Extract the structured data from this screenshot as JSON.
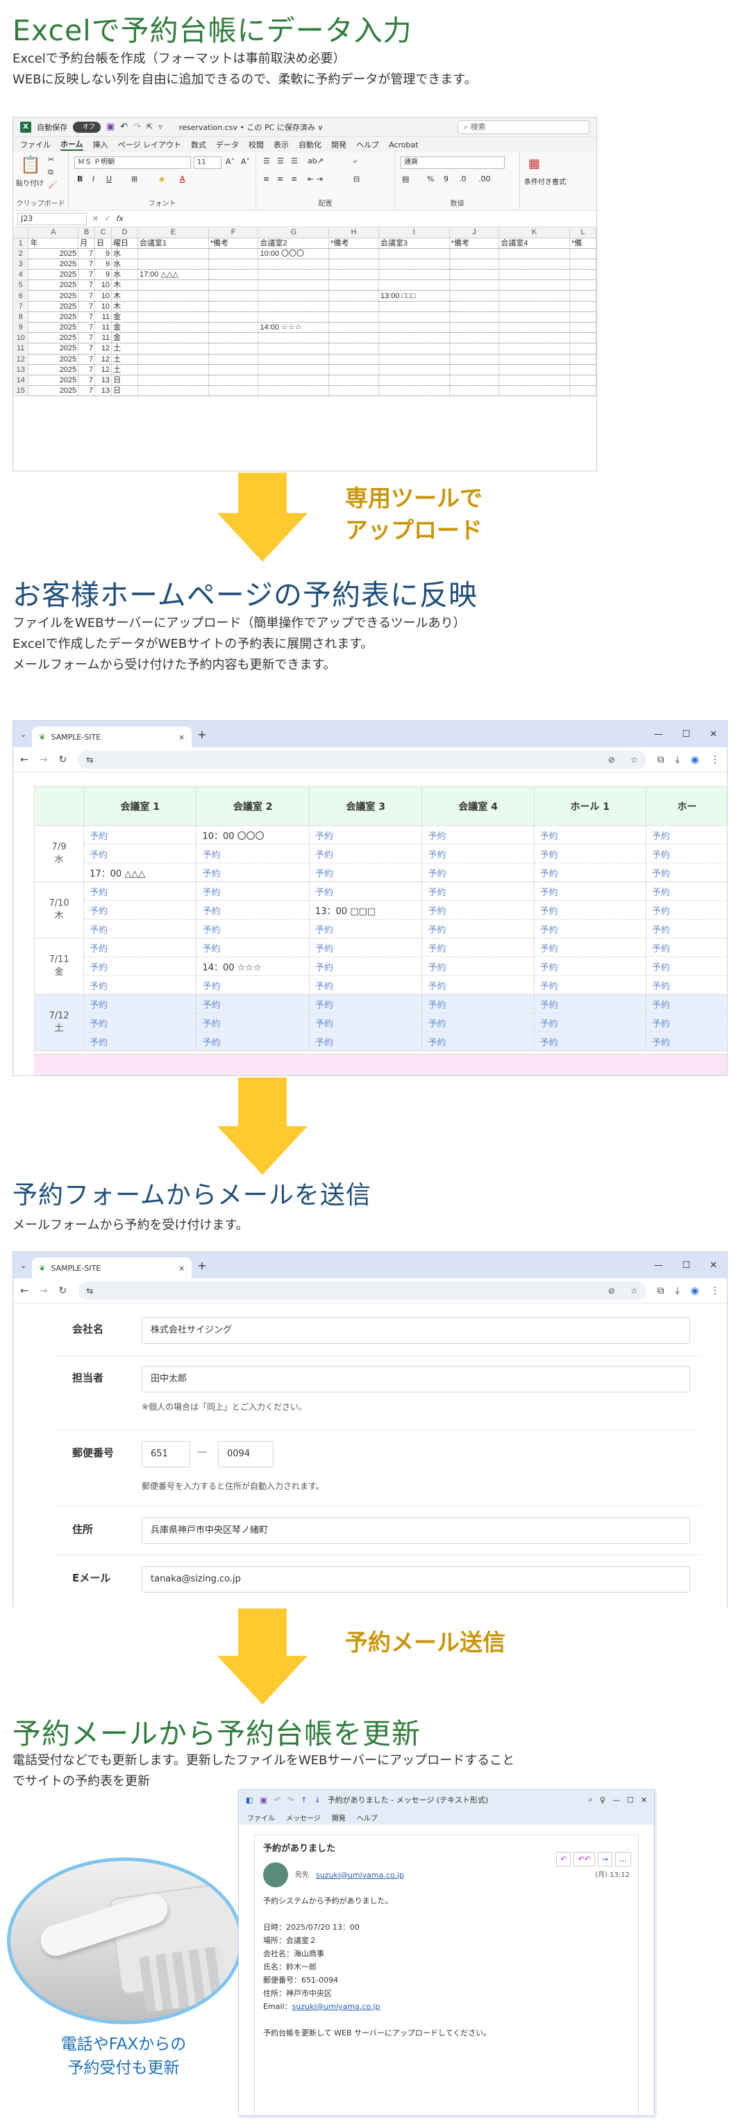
{
  "section1": {
    "title": "Excelで予約台帳にデータ入力",
    "desc": [
      "Excelで予約台帳を作成（フォーマットは事前取決め必要）",
      "WEBに反映しない列を自由に追加できるので、柔軟に予約データが管理できます。"
    ]
  },
  "excel": {
    "autosave": "自動保存",
    "toggle": "オフ",
    "filename": "reservation.csv • この PC に保存済み ∨",
    "search": "検索",
    "menu": [
      "ファイル",
      "ホーム",
      "挿入",
      "ページ レイアウト",
      "数式",
      "データ",
      "校閲",
      "表示",
      "自動化",
      "開発",
      "ヘルプ",
      "Acrobat"
    ],
    "font": "ＭＳ Ｐ明朝",
    "fontsize": "11",
    "numformat": "通貨",
    "paste": "貼り付け",
    "groups": [
      "クリップボード",
      "フォント",
      "配置",
      "数値"
    ],
    "condfmt": "条件付き書式",
    "namebox": "J23",
    "fx": "fx",
    "columns": [
      "",
      "A",
      "B",
      "C",
      "D",
      "E",
      "F",
      "G",
      "H",
      "I",
      "J",
      "K",
      "L"
    ],
    "header": [
      "年",
      "月",
      "日",
      "曜日",
      "会議室1",
      "*備考",
      "会議室2",
      "*備考",
      "会議室3",
      "*備考",
      "会議室4",
      "*備"
    ],
    "rows": [
      [
        "2025",
        "7",
        "9",
        "水",
        "",
        "",
        "10:00 〇〇〇",
        "",
        "",
        "",
        "",
        ""
      ],
      [
        "2025",
        "7",
        "9",
        "水",
        "",
        "",
        "",
        "",
        "",
        "",
        "",
        ""
      ],
      [
        "2025",
        "7",
        "9",
        "水",
        "17:00 △△△",
        "",
        "",
        "",
        "",
        "",
        "",
        ""
      ],
      [
        "2025",
        "7",
        "10",
        "木",
        "",
        "",
        "",
        "",
        "",
        "",
        "",
        ""
      ],
      [
        "2025",
        "7",
        "10",
        "木",
        "",
        "",
        "",
        "",
        "13:00 □□□",
        "",
        "",
        ""
      ],
      [
        "2025",
        "7",
        "10",
        "木",
        "",
        "",
        "",
        "",
        "",
        "",
        "",
        ""
      ],
      [
        "2025",
        "7",
        "11",
        "金",
        "",
        "",
        "",
        "",
        "",
        "",
        "",
        ""
      ],
      [
        "2025",
        "7",
        "11",
        "金",
        "",
        "",
        "14:00 ☆☆☆",
        "",
        "",
        "",
        "",
        ""
      ],
      [
        "2025",
        "7",
        "11",
        "金",
        "",
        "",
        "",
        "",
        "",
        "",
        "",
        ""
      ],
      [
        "2025",
        "7",
        "12",
        "土",
        "",
        "",
        "",
        "",
        "",
        "",
        "",
        ""
      ],
      [
        "2025",
        "7",
        "12",
        "土",
        "",
        "",
        "",
        "",
        "",
        "",
        "",
        ""
      ],
      [
        "2025",
        "7",
        "12",
        "土",
        "",
        "",
        "",
        "",
        "",
        "",
        "",
        ""
      ],
      [
        "2025",
        "7",
        "13",
        "日",
        "",
        "",
        "",
        "",
        "",
        "",
        "",
        ""
      ],
      [
        "2025",
        "7",
        "13",
        "日",
        "",
        "",
        "",
        "",
        "",
        "",
        "",
        ""
      ]
    ]
  },
  "arrow1": [
    "専用ツールで",
    "アップロード"
  ],
  "section2": {
    "title": "お客様ホームページの予約表に反映",
    "desc": [
      "ファイルをWEBサーバーにアップロード（簡単操作でアップできるツールあり）",
      "Excelで作成したデータがWEBサイトの予約表に展開されます。",
      "メールフォームから受け付けた予約内容も更新できます。"
    ]
  },
  "browser": {
    "tab": "SAMPLE-SITE",
    "close": "×",
    "newtab": "+",
    "url_icon": "⇆"
  },
  "schedule": {
    "columns": [
      "会議室 1",
      "会議室 2",
      "会議室 3",
      "会議室 4",
      "ホール 1",
      "ホー"
    ],
    "days": [
      {
        "date": "7/9",
        "dow": "水",
        "type": "",
        "slots": [
          [
            "予約",
            "10：00 〇〇〇",
            "予約",
            "予約",
            "予約",
            "予約"
          ],
          [
            "予約",
            "予約",
            "予約",
            "予約",
            "予約",
            "予約"
          ],
          [
            "17：00 △△△",
            "予約",
            "予約",
            "予約",
            "予約",
            "予約"
          ]
        ]
      },
      {
        "date": "7/10",
        "dow": "木",
        "type": "",
        "slots": [
          [
            "予約",
            "予約",
            "予約",
            "予約",
            "予約",
            "予約"
          ],
          [
            "予約",
            "予約",
            "13：00 □□□",
            "予約",
            "予約",
            "予約"
          ],
          [
            "予約",
            "予約",
            "予約",
            "予約",
            "予約",
            "予約"
          ]
        ]
      },
      {
        "date": "7/11",
        "dow": "金",
        "type": "",
        "slots": [
          [
            "予約",
            "予約",
            "予約",
            "予約",
            "予約",
            "予約"
          ],
          [
            "予約",
            "14：00 ☆☆☆",
            "予約",
            "予約",
            "予約",
            "予約"
          ],
          [
            "予約",
            "予約",
            "予約",
            "予約",
            "予約",
            "予約"
          ]
        ]
      },
      {
        "date": "7/12",
        "dow": "土",
        "type": "sat",
        "slots": [
          [
            "予約",
            "予約",
            "予約",
            "予約",
            "予約",
            "予約"
          ],
          [
            "予約",
            "予約",
            "予約",
            "予約",
            "予約",
            "予約"
          ],
          [
            "予約",
            "予約",
            "予約",
            "予約",
            "予約",
            "予約"
          ]
        ]
      }
    ]
  },
  "section3": {
    "title": "予約フォームからメールを送信",
    "desc": [
      "メールフォームから予約を受け付けます。"
    ]
  },
  "form": {
    "company_label": "会社名",
    "company_value": "株式会社サイジング",
    "person_label": "担当者",
    "person_value": "田中太郎",
    "person_note": "※個人の場合は「同上」とご入力ください。",
    "zip_label": "郵便番号",
    "zip1": "651",
    "zip_sep": "—",
    "zip2": "0094",
    "zip_note": "郵便番号を入力すると住所が自動入力されます。",
    "address_label": "住所",
    "address_value": "兵庫県神戸市中央区琴ノ緒町",
    "email_label": "Eメール",
    "email_value": "tanaka@sizing.co.jp"
  },
  "arrow3": [
    "予約メール送信"
  ],
  "section4": {
    "title": "予約メールから予約台帳を更新",
    "desc": [
      "電話受付などでも更新します。更新したファイルをWEBサーバーにアップロードすること",
      "でサイトの予約表を更新"
    ]
  },
  "mail": {
    "window_title": "予約がありました - メッセージ (テキスト形式)",
    "menu": [
      "ファイル",
      "メッセージ",
      "開発",
      "ヘルプ"
    ],
    "subject": "予約がありました",
    "from_prefix": "宛先",
    "from": "suzuki@umiyama.co.jp",
    "time": "(月) 13:12",
    "lines": [
      "予約システムから予約がありました。",
      "",
      "日時：2025/07/20 13：00",
      "場所：会議室２",
      "会社名：海山商事",
      "氏名：鈴木一郎",
      "郵便番号：651-0094",
      "住所：神戸市中央区"
    ],
    "email_label": "Email：",
    "email": "suzuki@umiyama.co.jp",
    "footer": "予約台帳を更新して WEB サーバーにアップロードしてください。"
  },
  "phone_caption": [
    "電話やFAXからの",
    "予約受付も更新"
  ],
  "colors": {
    "green": "#2f7d3c",
    "blue": "#1f4e79",
    "arrow": "#ffc930",
    "arrow_text": "#c9960a"
  }
}
